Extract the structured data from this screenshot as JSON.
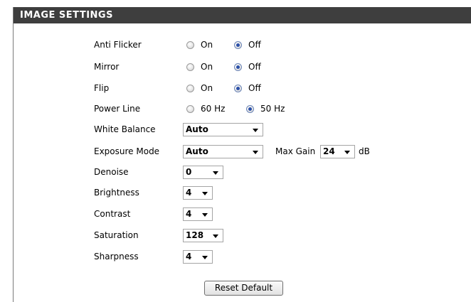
{
  "section_title": "IMAGE SETTINGS",
  "anti_flicker": {
    "label": "Anti Flicker",
    "on": "On",
    "off": "Off",
    "selected": "Off"
  },
  "mirror": {
    "label": "Mirror",
    "on": "On",
    "off": "Off",
    "selected": "Off"
  },
  "flip": {
    "label": "Flip",
    "on": "On",
    "off": "Off",
    "selected": "Off"
  },
  "power_line": {
    "label": "Power Line",
    "opt1": "60 Hz",
    "opt2": "50 Hz",
    "selected": "50 Hz"
  },
  "white_balance": {
    "label": "White Balance",
    "value": "Auto"
  },
  "exposure_mode": {
    "label": "Exposure Mode",
    "value": "Auto",
    "max_gain_label": "Max Gain",
    "max_gain_value": "24",
    "unit": "dB"
  },
  "denoise": {
    "label": "Denoise",
    "value": "0"
  },
  "brightness": {
    "label": "Brightness",
    "value": "4"
  },
  "contrast": {
    "label": "Contrast",
    "value": "4"
  },
  "saturation": {
    "label": "Saturation",
    "value": "128"
  },
  "sharpness": {
    "label": "Sharpness",
    "value": "4"
  },
  "reset_button": "Reset Default",
  "colors": {
    "header_bg": "#3e3e3e",
    "radio_selected": "#2a4fa8"
  }
}
